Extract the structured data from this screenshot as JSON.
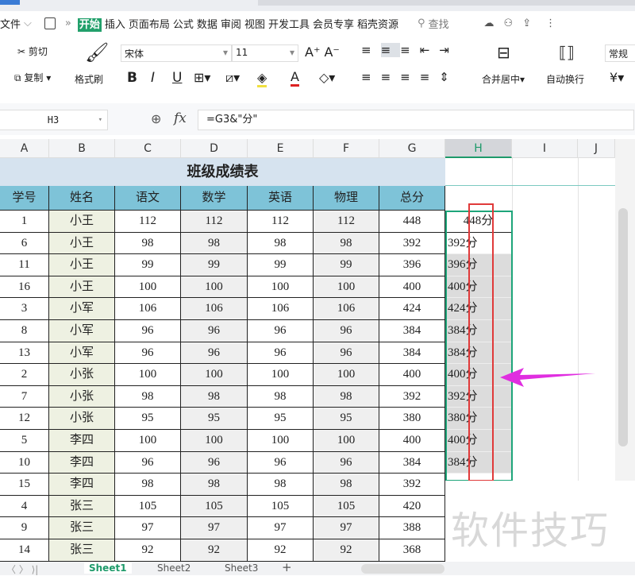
{
  "menu": {
    "file": "文件",
    "tabs": [
      "开始",
      "插入",
      "页面布局",
      "公式",
      "数据",
      "审阅",
      "视图",
      "开发工具",
      "会员专享",
      "稻壳资源"
    ],
    "search": "查找"
  },
  "ribbon": {
    "cut": "剪切",
    "copy": "复制",
    "format_painter": "格式刷",
    "font_name": "宋体",
    "font_size": "11",
    "bold": "B",
    "italic": "I",
    "underline": "U",
    "merge_center": "合并居中",
    "wrap_text": "自动换行",
    "number_format": "常规",
    "currency": "¥"
  },
  "formula_bar": {
    "cell_ref": "H3",
    "fx": "fx",
    "formula": "=G3&\"分\""
  },
  "columns": [
    "A",
    "B",
    "C",
    "D",
    "E",
    "F",
    "G",
    "H",
    "I",
    "J"
  ],
  "sheet": {
    "title": "班级成绩表",
    "headers": [
      "学号",
      "姓名",
      "语文",
      "数学",
      "英语",
      "物理",
      "总分"
    ],
    "rows": [
      [
        "1",
        "小王",
        "112",
        "112",
        "112",
        "112",
        "448",
        "448分"
      ],
      [
        "6",
        "小王",
        "98",
        "98",
        "98",
        "98",
        "392",
        "392分"
      ],
      [
        "11",
        "小王",
        "99",
        "99",
        "99",
        "99",
        "396",
        "396分"
      ],
      [
        "16",
        "小王",
        "100",
        "100",
        "100",
        "100",
        "400",
        "400分"
      ],
      [
        "3",
        "小军",
        "106",
        "106",
        "106",
        "106",
        "424",
        "424分"
      ],
      [
        "8",
        "小军",
        "96",
        "96",
        "96",
        "96",
        "384",
        "384分"
      ],
      [
        "13",
        "小军",
        "96",
        "96",
        "96",
        "96",
        "384",
        "384分"
      ],
      [
        "2",
        "小张",
        "100",
        "100",
        "100",
        "100",
        "400",
        "400分"
      ],
      [
        "7",
        "小张",
        "98",
        "98",
        "98",
        "98",
        "392",
        "392分"
      ],
      [
        "12",
        "小张",
        "95",
        "95",
        "95",
        "95",
        "380",
        "380分"
      ],
      [
        "5",
        "李四",
        "100",
        "100",
        "100",
        "100",
        "400",
        "400分"
      ],
      [
        "10",
        "李四",
        "96",
        "96",
        "96",
        "96",
        "384",
        "384分"
      ],
      [
        "15",
        "李四",
        "98",
        "98",
        "98",
        "98",
        "392",
        null
      ],
      [
        "4",
        "张三",
        "105",
        "105",
        "105",
        "105",
        "420",
        null
      ],
      [
        "9",
        "张三",
        "97",
        "97",
        "97",
        "97",
        "388",
        null
      ],
      [
        "14",
        "张三",
        "92",
        "92",
        "92",
        "92",
        "368",
        null
      ]
    ]
  },
  "sheet_tabs": [
    "Sheet1",
    "Sheet2",
    "Sheet3"
  ],
  "watermark": "软件技巧",
  "colors": {
    "accent": "#22a06b",
    "header": "#7ec3d8",
    "title": "#d6e3ef",
    "highlight": "#e03a3a",
    "arrow": "#e02ee0"
  }
}
